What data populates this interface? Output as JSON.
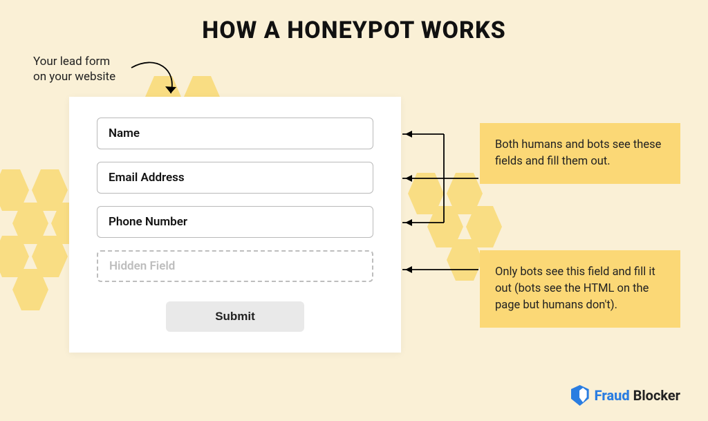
{
  "title": "HOW A HONEYPOT WORKS",
  "lead_caption_line1": "Your lead form",
  "lead_caption_line2": "on your website",
  "form": {
    "fields": [
      {
        "label": "Name"
      },
      {
        "label": "Email Address"
      },
      {
        "label": "Phone Number"
      },
      {
        "label": "Hidden Field"
      }
    ],
    "submit": "Submit"
  },
  "callouts": {
    "visible": "Both humans and bots see these fields and fill them out.",
    "hidden": "Only bots see this field and fill it out (bots see the HTML on the page but humans don't)."
  },
  "brand": {
    "word1": "Fraud",
    "word2": " Blocker"
  }
}
